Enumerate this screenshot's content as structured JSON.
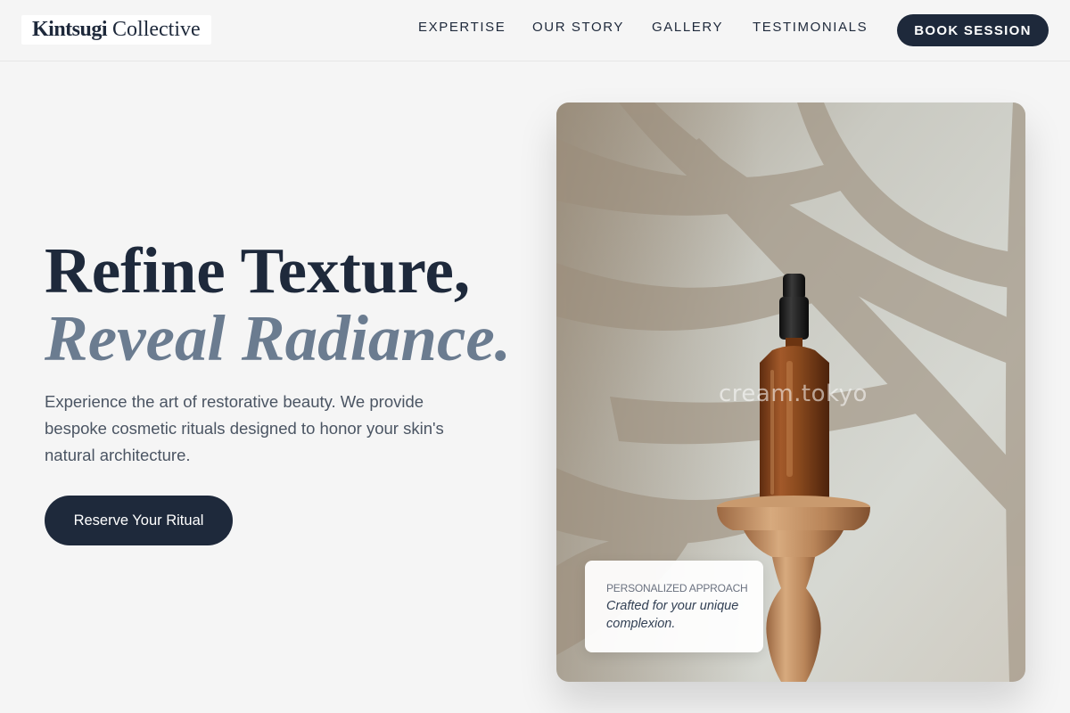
{
  "brand": {
    "name_bold": "Kintsugi",
    "name_light": "Collective"
  },
  "nav": {
    "items": [
      "EXPERTISE",
      "OUR STORY",
      "GALLERY",
      "TESTIMONIALS"
    ],
    "cta_label": "BOOK SESSION"
  },
  "hero": {
    "headline_line1": "Refine Texture,",
    "headline_line2": "Reveal Radiance.",
    "description": "Experience the art of restorative beauty. We provide bespoke cosmetic rituals designed to honor your skin's natural architecture.",
    "cta_label": "Reserve Your Ritual"
  },
  "image": {
    "watermark": "cream.tokyo",
    "overlay": {
      "title": "PERSONALIZED APPROACH",
      "text": "Crafted for your unique complexion."
    }
  },
  "colors": {
    "primary": "#1e293b",
    "accent_text": "#6b7c90",
    "background": "#f5f5f5",
    "photo_wall": "#d3d4ce",
    "bottle_amber": "#8a4a1e"
  }
}
